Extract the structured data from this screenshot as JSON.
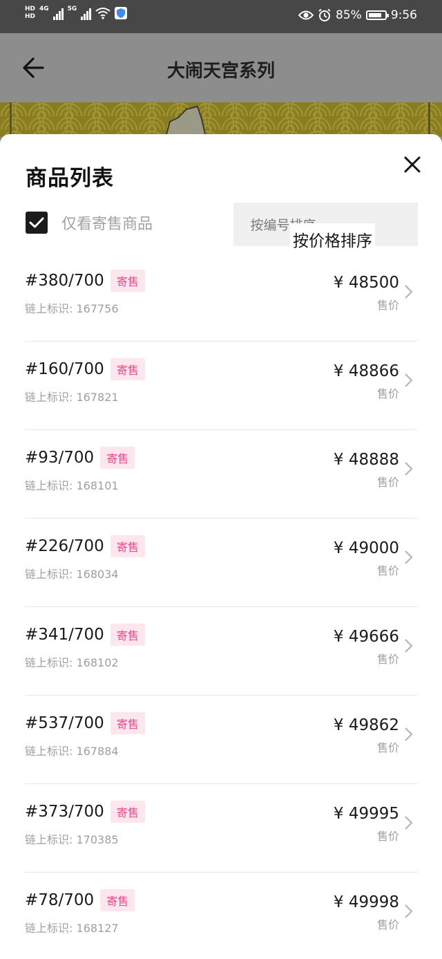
{
  "status_bar": {
    "hd1": "HD",
    "hd2": "HD",
    "net1": "4G",
    "net2": "5G",
    "battery_percent": "85%",
    "battery_level": 0.85,
    "time": "9:56"
  },
  "header": {
    "title": "大闹天宫系列"
  },
  "sheet": {
    "title": "商品列表",
    "only_consign_label": "仅看寄售商品",
    "only_consign_checked": true,
    "sort_by_number": "按编号排序",
    "sort_by_price": "按价格排序",
    "active_sort": "price"
  },
  "items": [
    {
      "edition": "#380/700",
      "badge": "寄售",
      "chain_id": "链上标识: 167756",
      "price": "¥ 48500",
      "price_label": "售价"
    },
    {
      "edition": "#160/700",
      "badge": "寄售",
      "chain_id": "链上标识: 167821",
      "price": "¥ 48866",
      "price_label": "售价"
    },
    {
      "edition": "#93/700",
      "badge": "寄售",
      "chain_id": "链上标识: 168101",
      "price": "¥ 48888",
      "price_label": "售价"
    },
    {
      "edition": "#226/700",
      "badge": "寄售",
      "chain_id": "链上标识: 168034",
      "price": "¥ 49000",
      "price_label": "售价"
    },
    {
      "edition": "#341/700",
      "badge": "寄售",
      "chain_id": "链上标识: 168102",
      "price": "¥ 49666",
      "price_label": "售价"
    },
    {
      "edition": "#537/700",
      "badge": "寄售",
      "chain_id": "链上标识: 167884",
      "price": "¥ 49862",
      "price_label": "售价"
    },
    {
      "edition": "#373/700",
      "badge": "寄售",
      "chain_id": "链上标识: 170385",
      "price": "¥ 49995",
      "price_label": "售价"
    },
    {
      "edition": "#78/700",
      "badge": "寄售",
      "chain_id": "链上标识: 168127",
      "price": "¥ 49998",
      "price_label": "售价"
    }
  ],
  "colors": {
    "badge_bg": "#fde6ee",
    "badge_text": "#e84a8f",
    "banner": "#8a7c21"
  }
}
